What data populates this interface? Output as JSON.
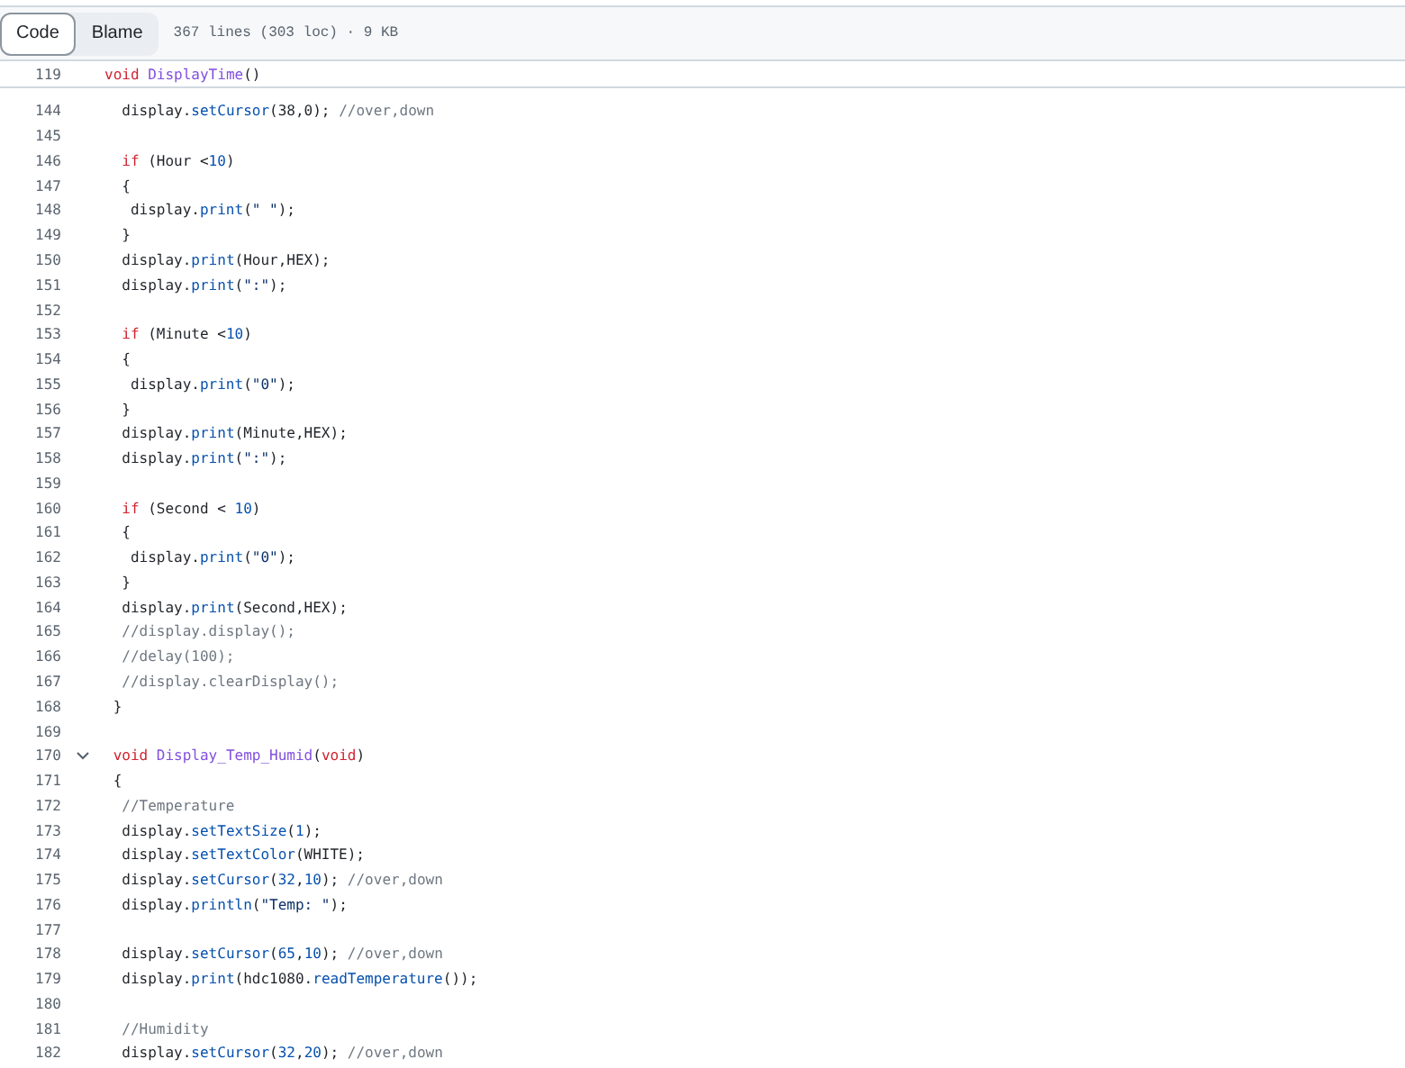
{
  "toolbar": {
    "tabs": [
      {
        "label": "Code",
        "selected": true
      },
      {
        "label": "Blame",
        "selected": false
      }
    ],
    "file_info": "367 lines (303 loc) · 9 KB"
  },
  "sticky_line": {
    "number": "119",
    "tokens": [
      {
        "text": "void ",
        "kind": "keyword"
      },
      {
        "text": "DisplayTime",
        "kind": "function"
      },
      {
        "text": "()",
        "kind": "plain"
      }
    ]
  },
  "lines": [
    {
      "number": "144",
      "fold_toggle": false,
      "tokens": [
        {
          "text": "  display.",
          "kind": "plain"
        },
        {
          "text": "setCursor",
          "kind": "method"
        },
        {
          "text": "(38,0); ",
          "kind": "plain"
        },
        {
          "text": "//over,down",
          "kind": "comment"
        }
      ]
    },
    {
      "number": "145",
      "fold_toggle": false
    },
    {
      "number": "146",
      "fold_toggle": false,
      "tokens": [
        {
          "text": "  if",
          "kind": "keyword"
        },
        {
          "text": " (Hour <",
          "kind": "plain"
        },
        {
          "text": "10",
          "kind": "number"
        },
        {
          "text": ")",
          "kind": "plain"
        }
      ]
    },
    {
      "number": "147",
      "fold_toggle": false,
      "tokens": [
        {
          "text": "  {",
          "kind": "plain"
        }
      ]
    },
    {
      "number": "148",
      "fold_toggle": false,
      "tokens": [
        {
          "text": "   display.",
          "kind": "plain"
        },
        {
          "text": "print",
          "kind": "method"
        },
        {
          "text": "(",
          "kind": "plain"
        },
        {
          "text": "\" \"",
          "kind": "string"
        },
        {
          "text": ");",
          "kind": "plain"
        }
      ]
    },
    {
      "number": "149",
      "fold_toggle": false,
      "tokens": [
        {
          "text": "  }",
          "kind": "plain"
        }
      ]
    },
    {
      "number": "150",
      "fold_toggle": false,
      "tokens": [
        {
          "text": "  display.",
          "kind": "plain"
        },
        {
          "text": "print",
          "kind": "method"
        },
        {
          "text": "(Hour,HEX);",
          "kind": "plain"
        }
      ]
    },
    {
      "number": "151",
      "fold_toggle": false,
      "tokens": [
        {
          "text": "  display.",
          "kind": "plain"
        },
        {
          "text": "print",
          "kind": "method"
        },
        {
          "text": "(",
          "kind": "plain"
        },
        {
          "text": "\":\"",
          "kind": "string"
        },
        {
          "text": ");",
          "kind": "plain"
        }
      ]
    },
    {
      "number": "152",
      "fold_toggle": false
    },
    {
      "number": "153",
      "fold_toggle": false,
      "tokens": [
        {
          "text": "  if",
          "kind": "keyword"
        },
        {
          "text": " (Minute <",
          "kind": "plain"
        },
        {
          "text": "10",
          "kind": "number"
        },
        {
          "text": ")",
          "kind": "plain"
        }
      ]
    },
    {
      "number": "154",
      "fold_toggle": false,
      "tokens": [
        {
          "text": "  {",
          "kind": "plain"
        }
      ]
    },
    {
      "number": "155",
      "fold_toggle": false,
      "tokens": [
        {
          "text": "   display.",
          "kind": "plain"
        },
        {
          "text": "print",
          "kind": "method"
        },
        {
          "text": "(",
          "kind": "plain"
        },
        {
          "text": "\"0\"",
          "kind": "string"
        },
        {
          "text": ");",
          "kind": "plain"
        }
      ]
    },
    {
      "number": "156",
      "fold_toggle": false,
      "tokens": [
        {
          "text": "  }",
          "kind": "plain"
        }
      ]
    },
    {
      "number": "157",
      "fold_toggle": false,
      "tokens": [
        {
          "text": "  display.",
          "kind": "plain"
        },
        {
          "text": "print",
          "kind": "method"
        },
        {
          "text": "(Minute,HEX);",
          "kind": "plain"
        }
      ]
    },
    {
      "number": "158",
      "fold_toggle": false,
      "tokens": [
        {
          "text": "  display.",
          "kind": "plain"
        },
        {
          "text": "print",
          "kind": "method"
        },
        {
          "text": "(",
          "kind": "plain"
        },
        {
          "text": "\":\"",
          "kind": "string"
        },
        {
          "text": ");",
          "kind": "plain"
        }
      ]
    },
    {
      "number": "159",
      "fold_toggle": false
    },
    {
      "number": "160",
      "fold_toggle": false,
      "tokens": [
        {
          "text": "  if",
          "kind": "keyword"
        },
        {
          "text": " (Second < ",
          "kind": "plain"
        },
        {
          "text": "10",
          "kind": "number"
        },
        {
          "text": ")",
          "kind": "plain"
        }
      ]
    },
    {
      "number": "161",
      "fold_toggle": false,
      "tokens": [
        {
          "text": "  {",
          "kind": "plain"
        }
      ]
    },
    {
      "number": "162",
      "fold_toggle": false,
      "tokens": [
        {
          "text": "   display.",
          "kind": "plain"
        },
        {
          "text": "print",
          "kind": "method"
        },
        {
          "text": "(",
          "kind": "plain"
        },
        {
          "text": "\"0\"",
          "kind": "string"
        },
        {
          "text": ");",
          "kind": "plain"
        }
      ]
    },
    {
      "number": "163",
      "fold_toggle": false,
      "tokens": [
        {
          "text": "  }",
          "kind": "plain"
        }
      ]
    },
    {
      "number": "164",
      "fold_toggle": false,
      "tokens": [
        {
          "text": "  display.",
          "kind": "plain"
        },
        {
          "text": "print",
          "kind": "method"
        },
        {
          "text": "(Second,HEX);",
          "kind": "plain"
        }
      ]
    },
    {
      "number": "165",
      "fold_toggle": false,
      "tokens": [
        {
          "text": "  //display.display();",
          "kind": "comment"
        }
      ]
    },
    {
      "number": "166",
      "fold_toggle": false,
      "tokens": [
        {
          "text": "  //delay(100);",
          "kind": "comment"
        }
      ]
    },
    {
      "number": "167",
      "fold_toggle": false,
      "tokens": [
        {
          "text": "  //display.clearDisplay();",
          "kind": "comment"
        }
      ]
    },
    {
      "number": "168",
      "fold_toggle": false,
      "tokens": [
        {
          "text": " }",
          "kind": "plain"
        }
      ]
    },
    {
      "number": "169",
      "fold_toggle": false
    },
    {
      "number": "170",
      "fold_toggle": true,
      "tokens": [
        {
          "text": " void ",
          "kind": "keyword"
        },
        {
          "text": "Display_Temp_Humid",
          "kind": "function"
        },
        {
          "text": "(",
          "kind": "plain"
        },
        {
          "text": "void",
          "kind": "keyword"
        },
        {
          "text": ")",
          "kind": "plain"
        }
      ]
    },
    {
      "number": "171",
      "fold_toggle": false,
      "tokens": [
        {
          "text": " {",
          "kind": "plain"
        }
      ]
    },
    {
      "number": "172",
      "fold_toggle": false,
      "tokens": [
        {
          "text": "  //Temperature",
          "kind": "comment"
        }
      ]
    },
    {
      "number": "173",
      "fold_toggle": false,
      "tokens": [
        {
          "text": "  display.",
          "kind": "plain"
        },
        {
          "text": "setTextSize",
          "kind": "method"
        },
        {
          "text": "(",
          "kind": "plain"
        },
        {
          "text": "1",
          "kind": "number"
        },
        {
          "text": ");",
          "kind": "plain"
        }
      ]
    },
    {
      "number": "174",
      "fold_toggle": false,
      "tokens": [
        {
          "text": "  display.",
          "kind": "plain"
        },
        {
          "text": "setTextColor",
          "kind": "method"
        },
        {
          "text": "(WHITE);",
          "kind": "plain"
        }
      ]
    },
    {
      "number": "175",
      "fold_toggle": false,
      "tokens": [
        {
          "text": "  display.",
          "kind": "plain"
        },
        {
          "text": "setCursor",
          "kind": "method"
        },
        {
          "text": "(",
          "kind": "plain"
        },
        {
          "text": "32",
          "kind": "number"
        },
        {
          "text": ",",
          "kind": "plain"
        },
        {
          "text": "10",
          "kind": "number"
        },
        {
          "text": "); ",
          "kind": "plain"
        },
        {
          "text": "//over,down",
          "kind": "comment"
        }
      ]
    },
    {
      "number": "176",
      "fold_toggle": false,
      "tokens": [
        {
          "text": "  display.",
          "kind": "plain"
        },
        {
          "text": "println",
          "kind": "method"
        },
        {
          "text": "(",
          "kind": "plain"
        },
        {
          "text": "\"Temp: \"",
          "kind": "string"
        },
        {
          "text": ");",
          "kind": "plain"
        }
      ]
    },
    {
      "number": "177",
      "fold_toggle": false
    },
    {
      "number": "178",
      "fold_toggle": false,
      "tokens": [
        {
          "text": "  display.",
          "kind": "plain"
        },
        {
          "text": "setCursor",
          "kind": "method"
        },
        {
          "text": "(",
          "kind": "plain"
        },
        {
          "text": "65",
          "kind": "number"
        },
        {
          "text": ",",
          "kind": "plain"
        },
        {
          "text": "10",
          "kind": "number"
        },
        {
          "text": "); ",
          "kind": "plain"
        },
        {
          "text": "//over,down",
          "kind": "comment"
        }
      ]
    },
    {
      "number": "179",
      "fold_toggle": false,
      "tokens": [
        {
          "text": "  display.",
          "kind": "plain"
        },
        {
          "text": "print",
          "kind": "method"
        },
        {
          "text": "(hdc1080.",
          "kind": "plain"
        },
        {
          "text": "readTemperature",
          "kind": "method"
        },
        {
          "text": "());",
          "kind": "plain"
        }
      ]
    },
    {
      "number": "180",
      "fold_toggle": false
    },
    {
      "number": "181",
      "fold_toggle": false,
      "tokens": [
        {
          "text": "  //Humidity",
          "kind": "comment"
        }
      ]
    },
    {
      "number": "182",
      "fold_toggle": false,
      "tokens": [
        {
          "text": "  display.",
          "kind": "plain"
        },
        {
          "text": "setCursor",
          "kind": "method"
        },
        {
          "text": "(",
          "kind": "plain"
        },
        {
          "text": "32",
          "kind": "number"
        },
        {
          "text": ",",
          "kind": "plain"
        },
        {
          "text": "20",
          "kind": "number"
        },
        {
          "text": "); ",
          "kind": "plain"
        },
        {
          "text": "//over,down",
          "kind": "comment"
        }
      ]
    }
  ]
}
